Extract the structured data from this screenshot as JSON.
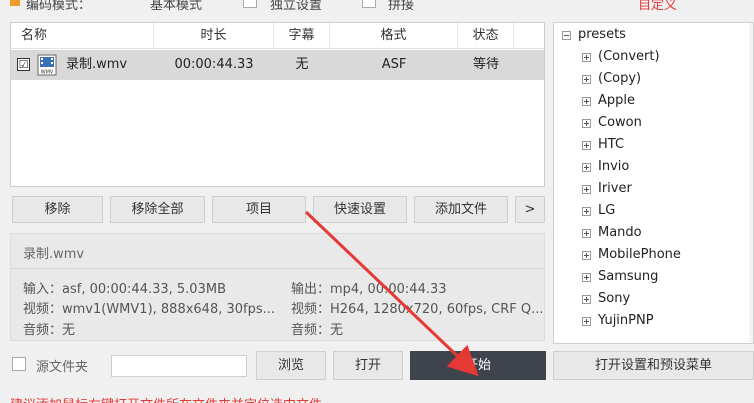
{
  "topbar": {
    "encode_mode_label": "编码模式：",
    "basic_mode_label": "基本模式",
    "independent_label": "独立设置",
    "splice_label": "拼接",
    "custom_label": "自定义"
  },
  "filelist": {
    "columns": [
      "名称",
      "时长",
      "字幕",
      "格式",
      "状态"
    ],
    "rows": [
      {
        "name": "录制.wmv",
        "duration": "00:00:44.33",
        "subtitle": "无",
        "format": "ASF",
        "status": "等待",
        "checked": "☑"
      }
    ]
  },
  "buttons": {
    "remove": "移除",
    "remove_all": "移除全部",
    "item": "项目",
    "quick_settings": "快速设置",
    "add_file": "添加文件",
    "more": ">"
  },
  "info": {
    "filename": "录制.wmv",
    "input": "输入：asf, 00:00:44.33, 5.03MB",
    "output": "输出：mp4, 00:00:44.33",
    "video_in": "视频：wmv1(WMV1), 888x648, 30fps...",
    "video_out": "视频：H264, 1280x720, 60fps, CRF Q...",
    "audio_in": "音频：无",
    "audio_out": "音频：无"
  },
  "tree": {
    "root": "presets",
    "items": [
      "(Convert)",
      "(Copy)",
      "Apple",
      "Cowon",
      "HTC",
      "Invio",
      "Iriver",
      "LG",
      "Mando",
      "MobilePhone",
      "Samsung",
      "Sony",
      "YujinPNP"
    ]
  },
  "bottom": {
    "source_folder": "源文件夹",
    "source_input_value": "",
    "browse": "浏览",
    "open": "打开",
    "start": "开始",
    "open_settings": "打开设置和预设菜单"
  },
  "hint": "建议添加鼠标右键打开文件所在文件夹并定位选中文件",
  "colors": {
    "accent_red": "#e23b3b",
    "start_button_bg": "#3f434c",
    "selected_row": "#d9d9d9",
    "arrow": "#e53935"
  }
}
